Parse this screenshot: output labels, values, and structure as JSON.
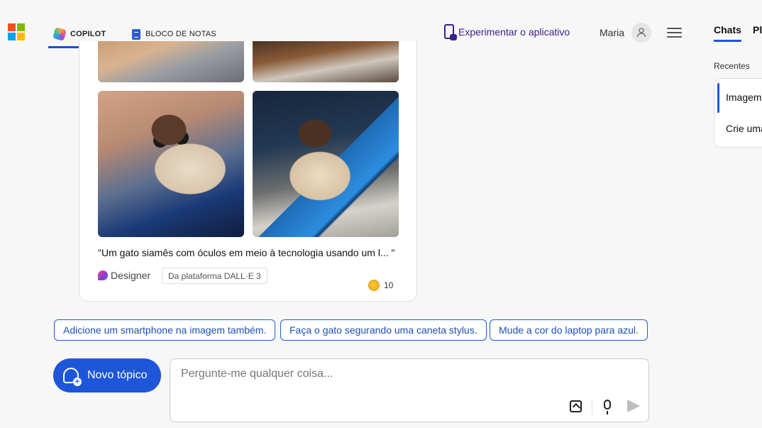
{
  "header": {
    "logo_colors": [
      "#f25022",
      "#7fba00",
      "#00a4ef",
      "#ffb900"
    ],
    "tabs": [
      {
        "label": "COPILOT",
        "active": true
      },
      {
        "label": "BLOCO DE NOTAS",
        "active": false
      }
    ],
    "try_app": "Experimentar o aplicativo",
    "user_name": "Maria"
  },
  "card": {
    "caption": "\"Um gato siamês com óculos em meio à tecnologia usando um l... \"",
    "designer_label": "Designer",
    "dalle_badge": "Da plataforma DALL·E 3",
    "boosts": "10"
  },
  "suggestions": [
    "Adicione um smartphone na imagem também.",
    "Faça o gato segurando uma caneta stylus.",
    "Mude a cor do laptop para azul."
  ],
  "input": {
    "new_topic": "Novo tópico",
    "placeholder": "Pergunte-me qualquer coisa..."
  },
  "right_panel": {
    "tabs": [
      "Chats",
      "Pl"
    ],
    "recent_label": "Recentes",
    "items": [
      "Imagem",
      "Crie uma"
    ]
  },
  "colors": {
    "accent": "#1d56d8",
    "app_link": "#3d1e8c",
    "coin": "#f2b72c"
  }
}
